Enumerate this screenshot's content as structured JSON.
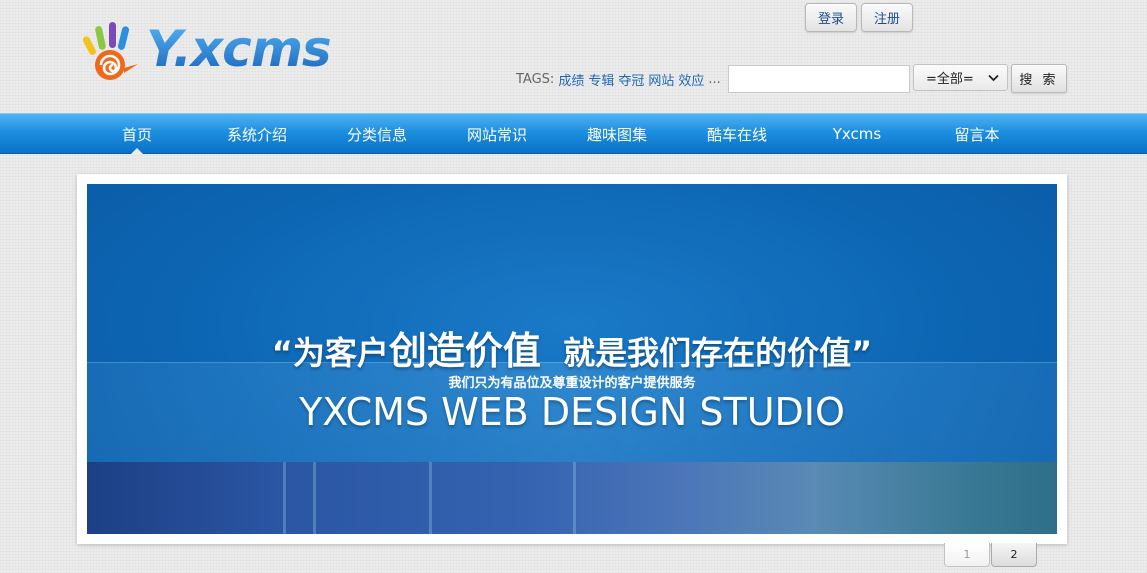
{
  "header": {
    "login_label": "登录",
    "register_label": "注册",
    "logo_text": "Y.xcms"
  },
  "tags": {
    "label": "TAGS:",
    "items": [
      "成绩",
      "专辑",
      "夺冠",
      "网站",
      "效应"
    ],
    "more": "..."
  },
  "search": {
    "value": "",
    "placeholder": "",
    "scope_selected": "=全部=",
    "button_label": "搜 索"
  },
  "nav": {
    "items": [
      {
        "label": "首页"
      },
      {
        "label": "系统介绍"
      },
      {
        "label": "分类信息"
      },
      {
        "label": "网站常识"
      },
      {
        "label": "趣味图集"
      },
      {
        "label": "酷车在线"
      },
      {
        "label": "Yxcms"
      },
      {
        "label": "留言本"
      }
    ],
    "active_index": 0
  },
  "banner": {
    "open_quote": "“",
    "slogan_part1": "为客户",
    "slogan_part2": "创造价值",
    "slogan_part3": "就是我们存在的价值",
    "close_quote": "”",
    "sub_slogan": "我们只为有品位及尊重设计的客户提供服务",
    "studio": "YXCMS WEB DESIGN STUDIO"
  },
  "pager": {
    "pages": [
      "1",
      "2"
    ],
    "active": "2"
  },
  "colors": {
    "nav_blue": "#1d8fe0",
    "banner_blue": "#0d66b3",
    "link_blue": "#2068b8"
  }
}
